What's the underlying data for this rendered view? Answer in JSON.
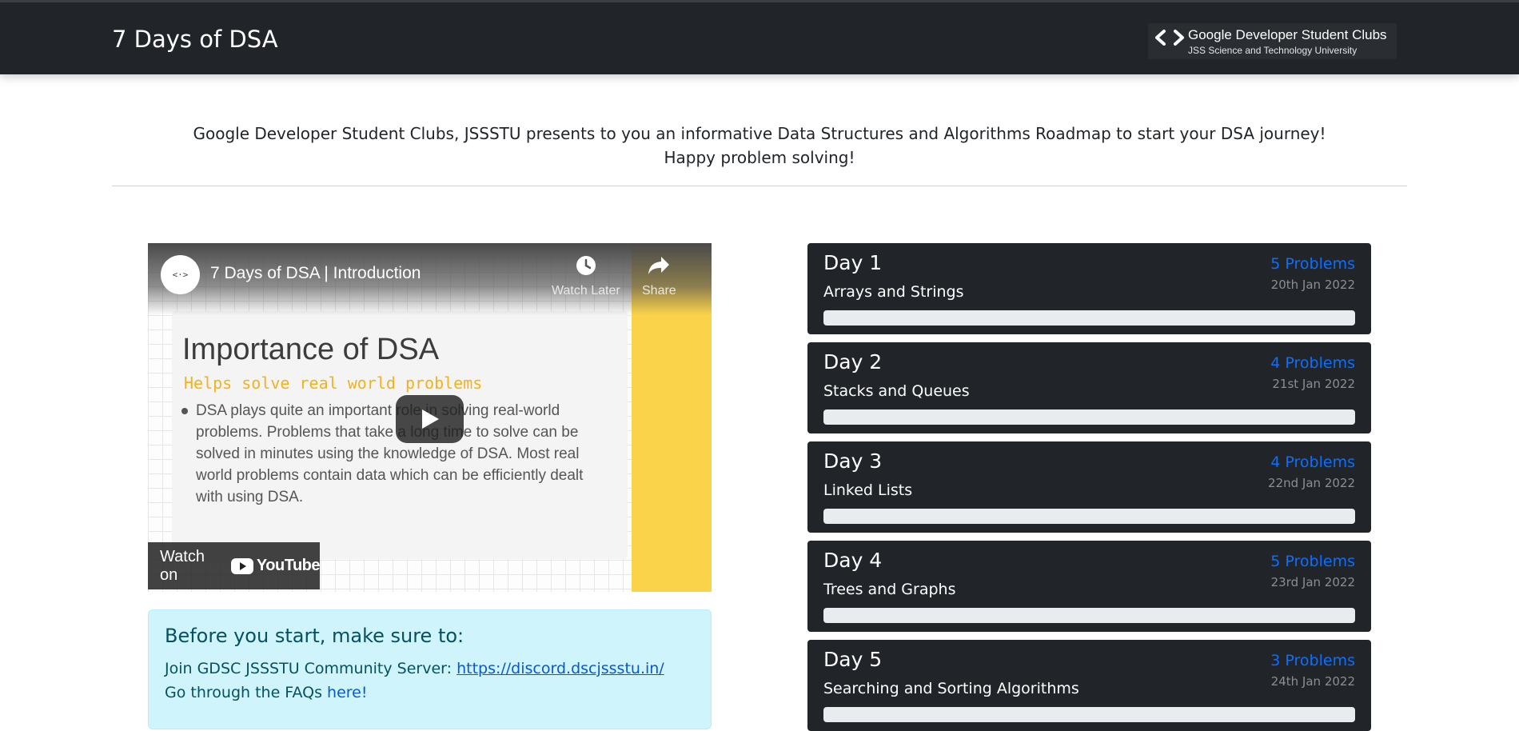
{
  "navbar": {
    "brand": "7 Days of DSA",
    "logo": {
      "name": "Google Developer Student Clubs",
      "university": "JSS Science and Technology University",
      "icon": "gdsc-brackets-icon"
    }
  },
  "intro": {
    "line1": "Google Developer Student Clubs, JSSSTU presents to you an informative Data Structures and Algorithms Roadmap to start your DSA journey!",
    "line2": "Happy problem solving!"
  },
  "video": {
    "title": "7 Days of DSA | Introduction",
    "avatar_text": "<·>",
    "watch_later": "Watch Later",
    "share": "Share",
    "slide_heading": "Importance of DSA",
    "slide_subheading": "Helps solve real world problems",
    "slide_body": "DSA plays quite an important role in solving real-world problems. Problems that take a long time to solve can be solved in minutes using the knowledge of DSA. Most real world problems contain data which can be efficiently dealt with using DSA.",
    "watch_on": "Watch on",
    "youtube": "YouTube"
  },
  "info": {
    "title": "Before you start, make sure to:",
    "join_text": "Join GDSC JSSSTU Community Server: ",
    "join_link": "https://discord.dscjssstu.in/",
    "faq_text": "Go through the FAQs ",
    "faq_link": "here!"
  },
  "days": [
    {
      "title": "Day 1",
      "topic": "Arrays and Strings",
      "count": "5 Problems",
      "date": "20th Jan 2022",
      "progress": 0
    },
    {
      "title": "Day 2",
      "topic": "Stacks and Queues",
      "count": "4 Problems",
      "date": "21st Jan 2022",
      "progress": 0
    },
    {
      "title": "Day 3",
      "topic": "Linked Lists",
      "count": "4 Problems",
      "date": "22nd Jan 2022",
      "progress": 0
    },
    {
      "title": "Day 4",
      "topic": "Trees and Graphs",
      "count": "5 Problems",
      "date": "23rd Jan 2022",
      "progress": 0
    },
    {
      "title": "Day 5",
      "topic": "Searching and Sorting Algorithms",
      "count": "3 Problems",
      "date": "24th Jan 2022",
      "progress": 0
    }
  ],
  "colors": {
    "navbar": "#212529",
    "accent_link": "#0d6efd",
    "info_bg": "#cff4fc",
    "info_text": "#055160",
    "progress_track": "#e9ecef"
  }
}
